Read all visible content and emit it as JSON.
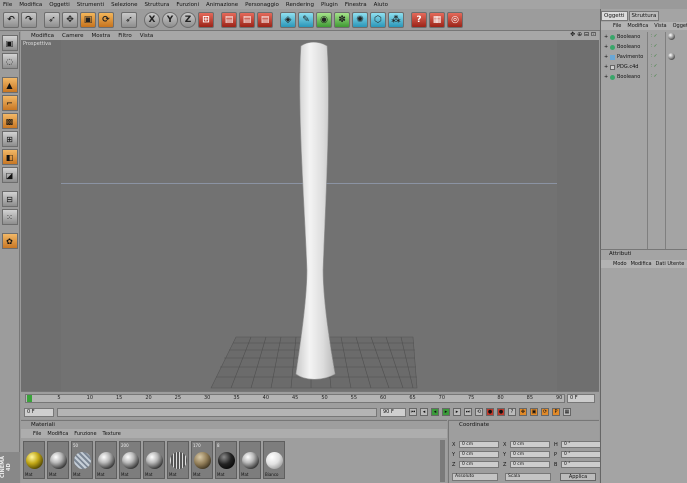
{
  "menubar": [
    "File",
    "Modifica",
    "Oggetti",
    "Strumenti",
    "Selezione",
    "Struttura",
    "Funzioni",
    "Animazione",
    "Personaggio",
    "Rendering",
    "Plugin",
    "Finestra",
    "Aiuto"
  ],
  "toolbar": {
    "x_axis": "X",
    "y_axis": "Y",
    "z_axis": "Z"
  },
  "viewport": {
    "menu": [
      "Modifica",
      "Camere",
      "Mostra",
      "Filtro",
      "Vista"
    ],
    "view_name": "Prospettiva",
    "nav_glyphs": "✥ ⊕ ⊟ ⊡"
  },
  "timeline": {
    "ticks": [
      "0",
      "5",
      "10",
      "15",
      "20",
      "25",
      "30",
      "35",
      "40",
      "45",
      "50",
      "55",
      "60",
      "65",
      "70",
      "75",
      "80",
      "85",
      "90"
    ],
    "current_frame": "0 F"
  },
  "playbar": {
    "start": "0 F",
    "end": "90 F"
  },
  "materials": {
    "title": "Materiali",
    "menu": [
      "File",
      "Modifica",
      "Funzione",
      "Texture"
    ],
    "items": [
      {
        "num": "",
        "name": "Mat",
        "kind": "gold"
      },
      {
        "num": "",
        "name": "Mat",
        "kind": "chrome"
      },
      {
        "num": "50",
        "name": "Mat",
        "kind": "glass"
      },
      {
        "num": "",
        "name": "Mat",
        "kind": "chrome"
      },
      {
        "num": "200",
        "name": "Mat",
        "kind": "chrome"
      },
      {
        "num": "",
        "name": "Mat",
        "kind": "chrome"
      },
      {
        "num": "",
        "name": "Mat",
        "kind": "wire"
      },
      {
        "num": "170",
        "name": "Mat",
        "kind": "brown"
      },
      {
        "num": "8",
        "name": "Mat",
        "kind": "black"
      },
      {
        "num": "",
        "name": "Mat",
        "kind": "chrome"
      },
      {
        "num": "",
        "name": "Bianco",
        "kind": "white"
      }
    ]
  },
  "coords": {
    "title": "Coordinate",
    "rows": [
      {
        "l1": "X",
        "v1": "0 cm",
        "l2": "X",
        "v2": "0 cm",
        "l3": "H",
        "v3": "0 °"
      },
      {
        "l1": "Y",
        "v1": "0 cm",
        "l2": "Y",
        "v2": "0 cm",
        "l3": "P",
        "v3": "0 °"
      },
      {
        "l1": "Z",
        "v1": "0 cm",
        "l2": "Z",
        "v2": "0 cm",
        "l3": "B",
        "v3": "0 °"
      }
    ],
    "mode": "Assoluto",
    "scale": "Scala",
    "apply": "Applica"
  },
  "brand": "CINEMA 4D",
  "objects": {
    "tabs": [
      "Oggetti",
      "Struttura"
    ],
    "menu": [
      "File",
      "Modifica",
      "Vista",
      "Oggetti"
    ],
    "items": [
      {
        "name": "Booleano",
        "icon": "sphere",
        "has_material": true
      },
      {
        "name": "Booleano",
        "icon": "sphere",
        "has_material": false
      },
      {
        "name": "Pavimento",
        "icon": "plane",
        "has_material": true
      },
      {
        "name": "PDG.c4d",
        "icon": "null",
        "has_material": false
      },
      {
        "name": "Booleano",
        "icon": "sphere",
        "has_material": false
      }
    ]
  },
  "attributes": {
    "title": "Attributi",
    "menu": [
      "Modo",
      "Modifica",
      "Dati Utente"
    ]
  }
}
